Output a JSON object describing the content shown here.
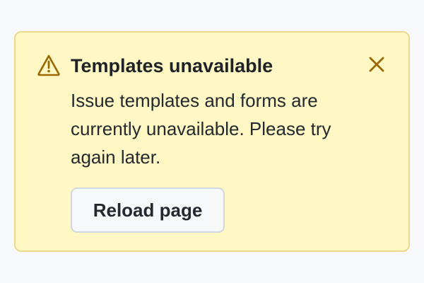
{
  "flash": {
    "title": "Templates unavailable",
    "message": "Issue templates and forms are currently unavailable. Please try again later.",
    "action_label": "Reload page",
    "icons": {
      "status": "warning-triangle-icon",
      "dismiss": "close-x-icon"
    },
    "colors": {
      "background": "#fff8c5",
      "border": "#ecd78a",
      "icon": "#9a6700",
      "text": "#24292f"
    }
  }
}
